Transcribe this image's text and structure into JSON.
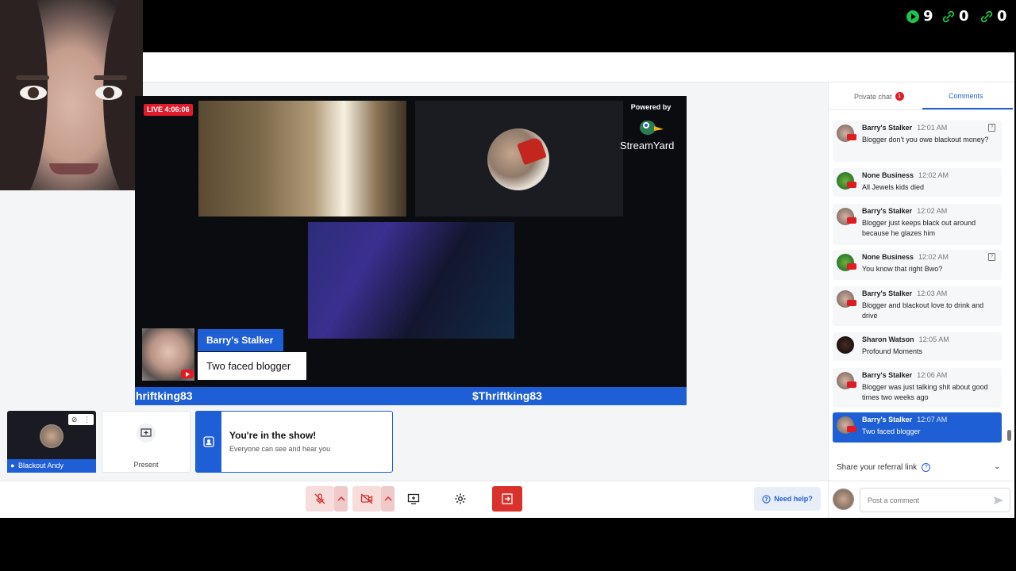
{
  "counters": [
    {
      "icon": "play-icon",
      "value": "9"
    },
    {
      "icon": "link-icon",
      "value": "0"
    },
    {
      "icon": "link-icon",
      "value": "0"
    }
  ],
  "stage": {
    "live_badge": "LIVE 4:06:06",
    "powered_by": "Powered by",
    "brand": "StreamYard",
    "lower_third": {
      "name": "Barry's Stalker",
      "message": "Two faced blogger"
    },
    "ticker": [
      "hriftking83",
      "$Thriftking83"
    ]
  },
  "tiles": {
    "self_name": "Blackout Andy",
    "present_label": "Present",
    "show_title": "You're in the show!",
    "show_subtitle": "Everyone can see and hear you"
  },
  "toolbar": {
    "need_help": "Need help?",
    "colors": {
      "accent": "#1f5fd6",
      "leave": "#d9312b",
      "muted_bg": "#f7dcdc"
    }
  },
  "panel": {
    "tabs": [
      {
        "label": "Private chat",
        "badge": "1"
      },
      {
        "label": "Comments"
      }
    ],
    "comments": [
      {
        "name": "Barry's Stalker",
        "time": "12:01 AM",
        "text": "Blogger don't you owe blackout money?"
      },
      {
        "name": "None Business",
        "time": "12:02 AM",
        "text": "All Jewels kids died"
      },
      {
        "name": "Barry's Stalker",
        "time": "12:02 AM",
        "text": "Blogger just keeps black out around because he glazes him"
      },
      {
        "name": "None Business",
        "time": "12:02 AM",
        "text": "You know that right Bwo?"
      },
      {
        "name": "Barry's Stalker",
        "time": "12:03 AM",
        "text": "Blogger and blackout love to drink and drive"
      },
      {
        "name": "Sharon Watson",
        "time": "12:05 AM",
        "text": "Profound Moments"
      },
      {
        "name": "Barry's Stalker",
        "time": "12:06 AM",
        "text": "Blogger was just talking shit about good times two weeks ago"
      },
      {
        "name": "Barry's Stalker",
        "time": "12:07 AM",
        "text": "Two faced blogger"
      }
    ],
    "referral": "Share your referral link",
    "post_placeholder": "Post a comment"
  }
}
